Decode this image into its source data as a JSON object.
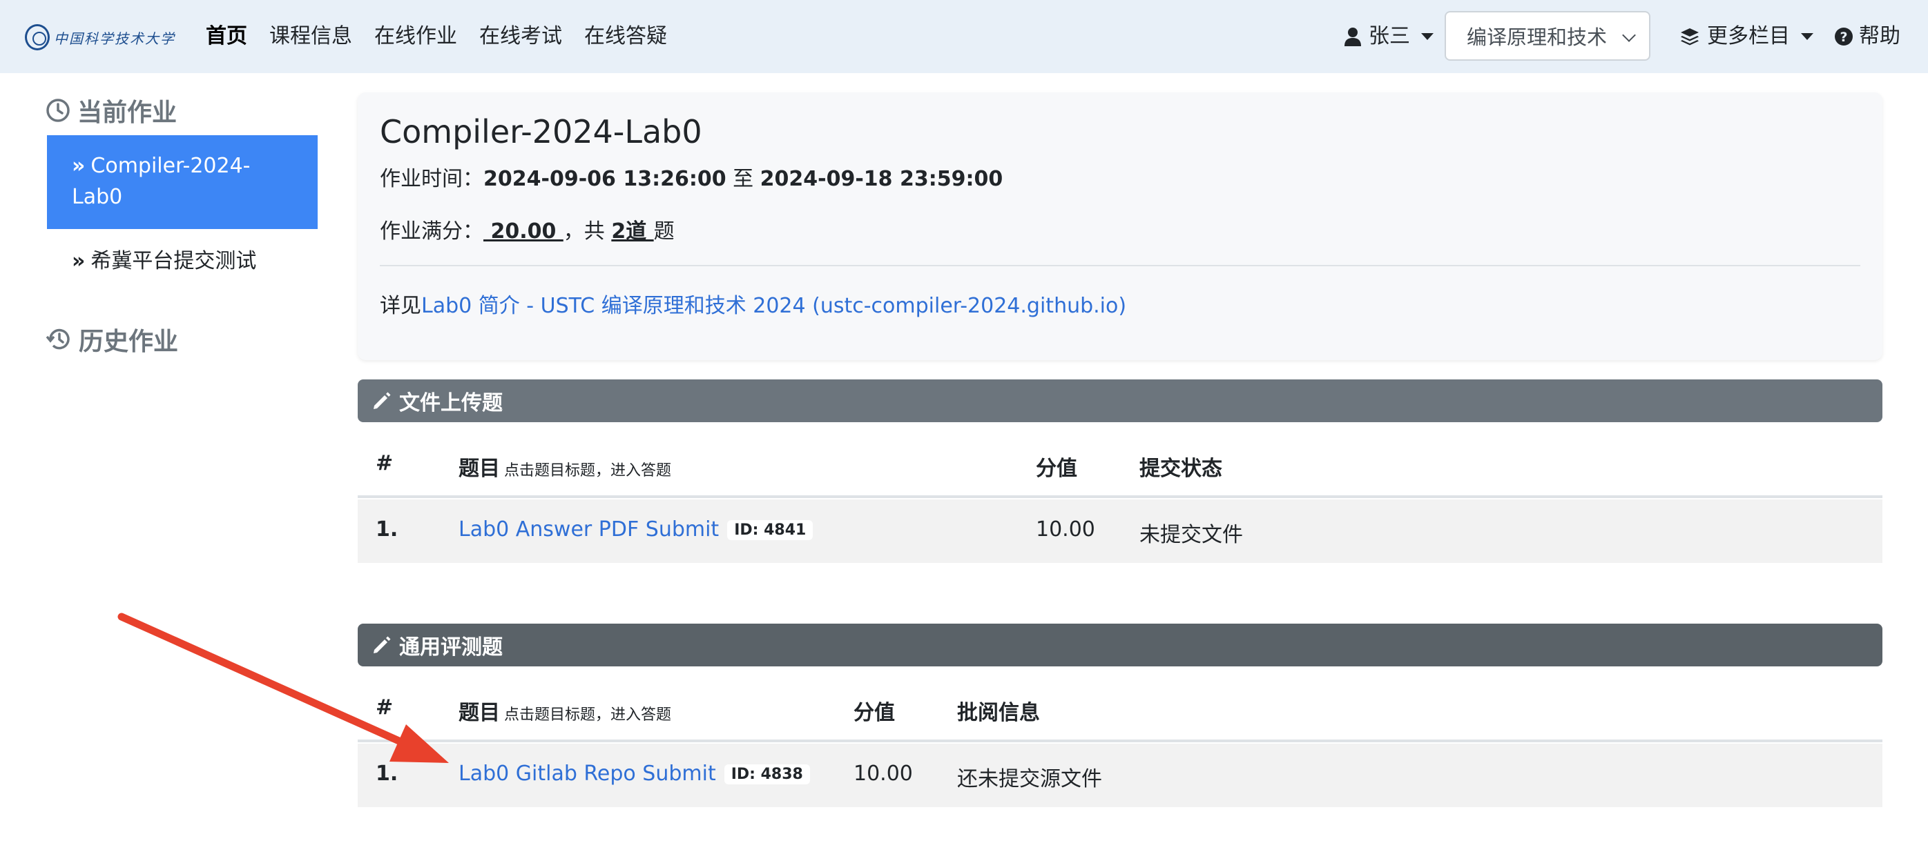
{
  "navbar": {
    "logo_text": "中国科学技术大学",
    "links": [
      "首页",
      "课程信息",
      "在线作业",
      "在线考试",
      "在线答疑"
    ],
    "user_name": "张三",
    "course_select": "编译原理和技术",
    "more_menu": "更多栏目",
    "help": "帮助"
  },
  "sidebar": {
    "current_heading": "当前作业",
    "current_items": [
      "Compiler-2024-Lab0",
      "希冀平台提交测试"
    ],
    "history_heading": "历史作业"
  },
  "homework": {
    "title": "Compiler-2024-Lab0",
    "time_label": "作业时间：",
    "start_time": "2024-09-06 13:26:00",
    "time_sep": " 至 ",
    "end_time": "2024-09-18 23:59:00",
    "score_label": "作业满分：",
    "full_score": " 20.00 ",
    "score_mid": "，共 ",
    "question_count": "2道 ",
    "score_suffix": "题",
    "detail_prefix": "详见",
    "detail_link": "Lab0 简介 - USTC 编译原理和技术 2024 (ustc-compiler-2024.github.io)"
  },
  "file_upload": {
    "section_title": "文件上传题",
    "headers": {
      "num": "#",
      "title": "题目",
      "title_hint": "点击题目标题，进入答题",
      "score": "分值",
      "status": "提交状态"
    },
    "rows": [
      {
        "num": "1.",
        "title": "Lab0 Answer PDF Submit",
        "id": "ID: 4841",
        "score": "10.00",
        "status": "未提交文件"
      }
    ]
  },
  "general_eval": {
    "section_title": "通用评测题",
    "headers": {
      "num": "#",
      "title": "题目",
      "title_hint": "点击题目标题，进入答题",
      "score": "分值",
      "review": "批阅信息"
    },
    "rows": [
      {
        "num": "1.",
        "title": "Lab0 Gitlab Repo Submit",
        "id": "ID: 4838",
        "score": "10.00",
        "review": "还未提交源文件"
      }
    ]
  },
  "colors": {
    "navbar_bg": "#e8f0f8",
    "active_item": "#3d86f5",
    "link": "#2f6fd6",
    "section_bar": "#6c757d",
    "arrow": "#e8412c"
  }
}
